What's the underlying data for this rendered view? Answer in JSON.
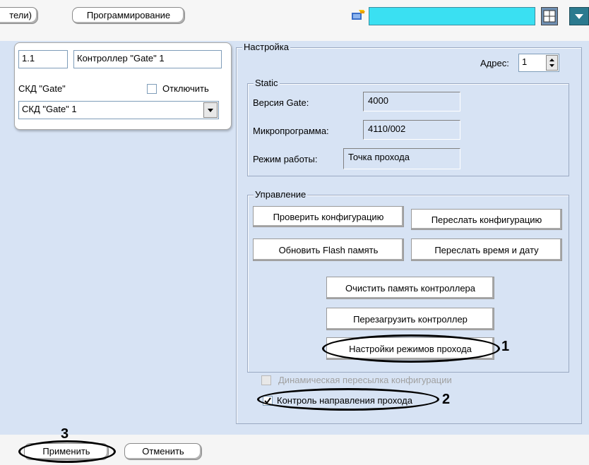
{
  "toolbar": {
    "tab_partial_label": "тели)",
    "programming_button": "Программирование"
  },
  "left_panel": {
    "id_value": "1.1",
    "name_value": "Контроллер \"Gate\" 1",
    "type_label": "СКД \"Gate\"",
    "disable_label": "Отключить",
    "device_select_value": "СКД \"Gate\" 1"
  },
  "settings": {
    "legend": "Настройка",
    "address_label": "Адрес:",
    "address_value": "1",
    "static": {
      "legend": "Static",
      "gate_version_label": "Версия Gate:",
      "gate_version_value": "4000",
      "firmware_label": "Микропрограмма:",
      "firmware_value": "4110/002",
      "mode_label": "Режим работы:",
      "mode_value": "Точка прохода"
    },
    "control": {
      "legend": "Управление",
      "check_config": "Проверить конфигурацию",
      "send_config": "Переслать конфигурацию",
      "update_flash": "Обновить Flash память",
      "send_datetime": "Переслать время и дату",
      "clear_memory": "Очистить память контроллера",
      "reboot": "Перезагрузить контроллер",
      "pass_mode_settings": "Настройки режимов прохода"
    },
    "dynamic_config_label": "Динамическая пересылка конфигурации",
    "direction_control_label": "Контроль направления прохода"
  },
  "annotations": {
    "callout_1": "1",
    "callout_2": "2",
    "callout_3": "3"
  },
  "bottom": {
    "apply": "Применить",
    "cancel": "Отменить"
  },
  "colors": {
    "panel_bg": "#d7e3f4",
    "search_field": "#3ae0f2",
    "dock_button": "#2b7a8f"
  }
}
